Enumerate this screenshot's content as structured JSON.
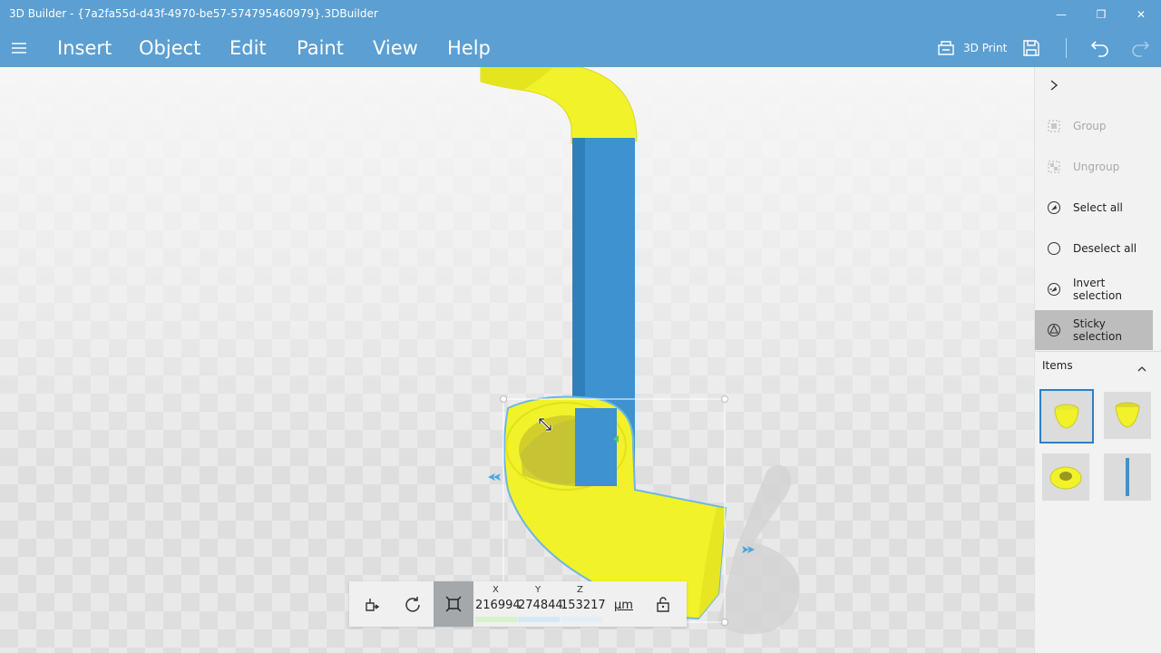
{
  "window": {
    "title": "3D Builder - {7a2fa55d-d43f-4970-be57-574795460979}.3DBuilder",
    "min_glyph": "—",
    "max_glyph": "❐",
    "close_glyph": "✕"
  },
  "menu": {
    "items": [
      "Insert",
      "Object",
      "Edit",
      "Paint",
      "View",
      "Help"
    ],
    "print_label": "3D Print"
  },
  "panel": {
    "actions": [
      {
        "label": "Group",
        "icon": "group-icon",
        "enabled": false
      },
      {
        "label": "Ungroup",
        "icon": "ungroup-icon",
        "enabled": false
      },
      {
        "label": "Select all",
        "icon": "select-all-icon",
        "enabled": true
      },
      {
        "label": "Deselect all",
        "icon": "deselect-all-icon",
        "enabled": true
      },
      {
        "label": "Invert selection",
        "icon": "invert-selection-icon",
        "enabled": true
      },
      {
        "label": "Sticky selection",
        "icon": "sticky-selection-icon",
        "enabled": true,
        "active": true
      }
    ],
    "items_heading": "Items",
    "thumbnails": [
      "cup-yellow",
      "cup-yellow-open",
      "ring-yellow",
      "rod-blue"
    ],
    "selected_thumbnail": 0
  },
  "toolbar": {
    "x_label": "X",
    "x_value": "216994",
    "y_label": "Y",
    "y_value": "274844",
    "z_label": "Z",
    "z_value": "153217",
    "unit": "µm"
  },
  "colors": {
    "accent": "#5b9fd3",
    "object_yellow": "#f2f22a",
    "object_blue": "#3d92cf",
    "selection_outline": "#6fb6e3"
  }
}
